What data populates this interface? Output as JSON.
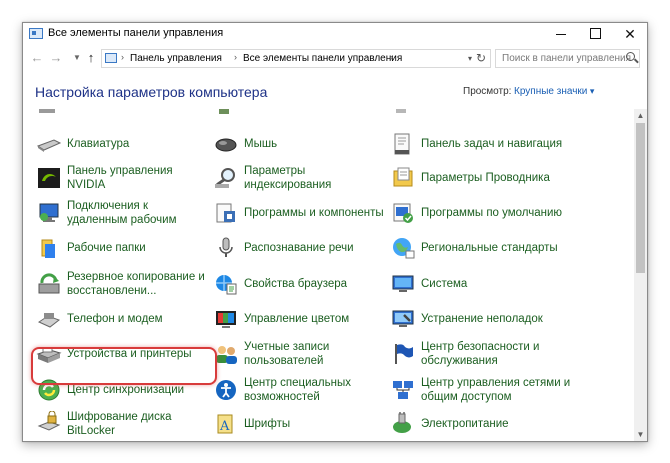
{
  "window": {
    "title": "Все элементы панели управления"
  },
  "breadcrumb": [
    "Панель управления",
    "Все элементы панели управления"
  ],
  "search": {
    "placeholder": "Поиск в панели управления"
  },
  "header": {
    "title": "Настройка параметров компьютера",
    "view_label": "Просмотр:",
    "view_value": "Крупные значки"
  },
  "items": {
    "col1": [
      {
        "label": "Клавиатура",
        "icon": "keyboard-icon"
      },
      {
        "label": "Панель управления NVIDIA",
        "icon": "nvidia-icon"
      },
      {
        "label": "Подключения к удаленным рабочим",
        "icon": "remote-desktop-icon"
      },
      {
        "label": "Рабочие папки",
        "icon": "work-folders-icon"
      },
      {
        "label": "Резервное копирование и восстановлени...",
        "icon": "backup-icon"
      },
      {
        "label": "Телефон и модем",
        "icon": "phone-modem-icon"
      },
      {
        "label": "Устройства и принтеры",
        "icon": "printer-icon"
      },
      {
        "label": "Центр синхронизации",
        "icon": "sync-center-icon"
      },
      {
        "label": "Шифрование диска BitLocker",
        "icon": "bitlocker-icon"
      }
    ],
    "col2": [
      {
        "label": "Мышь",
        "icon": "mouse-icon"
      },
      {
        "label": "Параметры индексирования",
        "icon": "indexing-icon"
      },
      {
        "label": "Программы и компоненты",
        "icon": "programs-icon"
      },
      {
        "label": "Распознавание речи",
        "icon": "microphone-icon"
      },
      {
        "label": "Свойства браузера",
        "icon": "browser-icon"
      },
      {
        "label": "Управление цветом",
        "icon": "color-management-icon"
      },
      {
        "label": "Учетные записи пользователей",
        "icon": "users-icon"
      },
      {
        "label": "Центр специальных возможностей",
        "icon": "accessibility-icon"
      },
      {
        "label": "Шрифты",
        "icon": "fonts-icon"
      }
    ],
    "col3": [
      {
        "label": "Панель задач и навигация",
        "icon": "taskbar-icon"
      },
      {
        "label": "Параметры Проводника",
        "icon": "folder-options-icon"
      },
      {
        "label": "Программы по умолчанию",
        "icon": "default-programs-icon"
      },
      {
        "label": "Региональные стандарты",
        "icon": "region-icon"
      },
      {
        "label": "Система",
        "icon": "system-icon"
      },
      {
        "label": "Устранение неполадок",
        "icon": "troubleshooting-icon"
      },
      {
        "label": "Центр безопасности и обслуживания",
        "icon": "security-flag-icon"
      },
      {
        "label": "Центр управления сетями и общим доступом",
        "icon": "network-icon"
      },
      {
        "label": "Электропитание",
        "icon": "power-icon"
      }
    ]
  },
  "colors": {
    "link": "#1b5e20",
    "heading": "#1e3287",
    "accent": "#1a5fb4",
    "highlight": "#d83b3b"
  }
}
